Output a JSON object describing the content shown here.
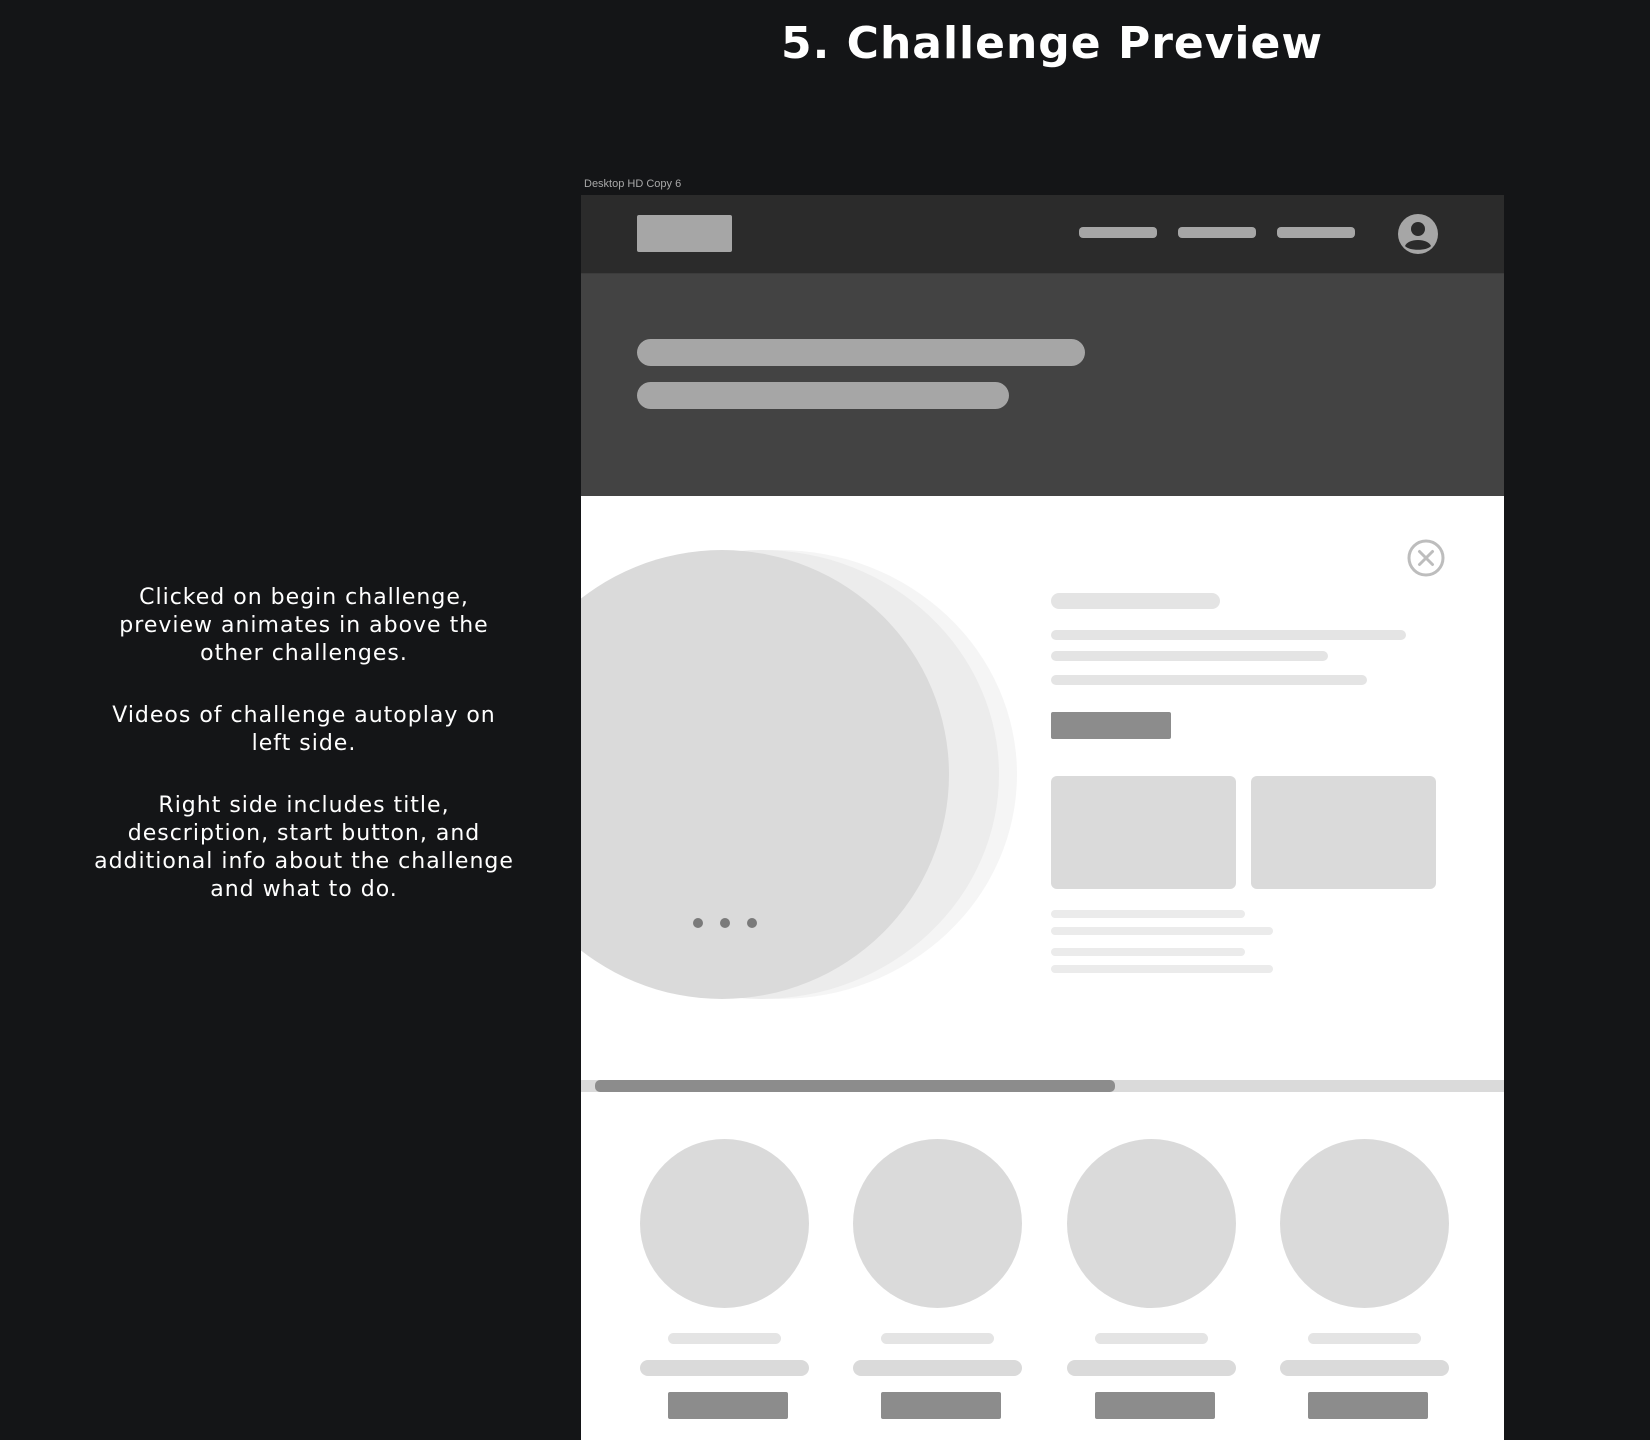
{
  "page": {
    "heading": "5. Challenge Preview",
    "notes": [
      "Clicked on begin challenge, preview animates in above the other challenges.",
      "Videos of challenge autoplay on left side.",
      "Right side includes title, description, start button, and additional info about the challenge and what to do."
    ]
  },
  "frame": {
    "label": "Desktop HD Copy 6"
  },
  "wireframe": {
    "nav": {
      "items": [
        "placeholder",
        "placeholder",
        "placeholder"
      ],
      "icons": [
        "logo-placeholder",
        "user-avatar-icon"
      ]
    },
    "preview": {
      "icons": [
        "close-icon",
        "loading-dots-icon"
      ],
      "video_dots": 3,
      "info_cards": 2,
      "scrollbar_progress": 0.55
    },
    "challenge_cards": 4
  },
  "colors": {
    "background": "#141517",
    "nav": "#2b2b2b",
    "hero": "#434343",
    "placeholder_dark": "#8c8c8c",
    "placeholder_mid": "#a6a6a6",
    "placeholder_light": "#dadada"
  }
}
